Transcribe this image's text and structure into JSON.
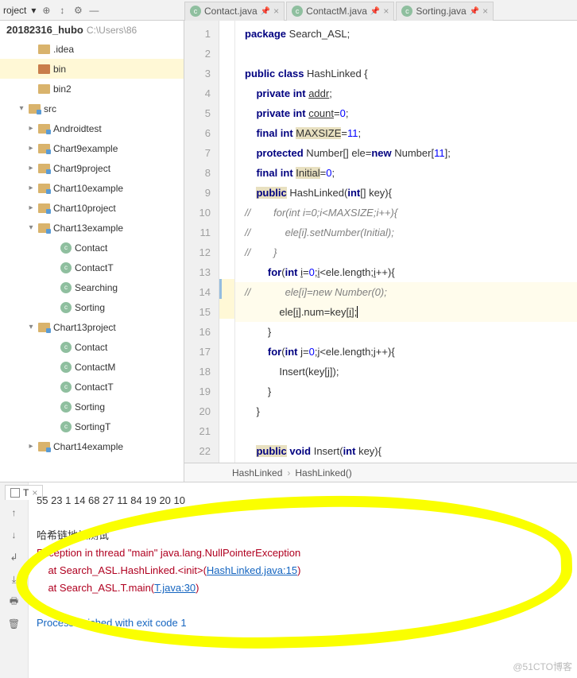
{
  "toolbar": {
    "project_label": "roject",
    "chev": "▾"
  },
  "tabs": [
    {
      "label": "Contact.java"
    },
    {
      "label": "ContactM.java"
    },
    {
      "label": "Sorting.java"
    }
  ],
  "project": {
    "root_name": "20182316_hubo",
    "root_path": "C:\\Users\\86"
  },
  "tree": [
    {
      "label": ".idea",
      "pl": 34,
      "chev": "",
      "icon": "fld"
    },
    {
      "label": "bin",
      "pl": 34,
      "chev": "",
      "icon": "fld open",
      "sel": true
    },
    {
      "label": "bin2",
      "pl": 34,
      "chev": "",
      "icon": "fld"
    },
    {
      "label": "src",
      "pl": 22,
      "chev": "▾",
      "icon": "fld blue"
    },
    {
      "label": "Androidtest",
      "pl": 34,
      "chev": "▸",
      "icon": "fld blue"
    },
    {
      "label": "Chart9example",
      "pl": 34,
      "chev": "▸",
      "icon": "fld blue"
    },
    {
      "label": "Chart9project",
      "pl": 34,
      "chev": "▸",
      "icon": "fld blue"
    },
    {
      "label": "Chart10example",
      "pl": 34,
      "chev": "▸",
      "icon": "fld blue"
    },
    {
      "label": "Chart10project",
      "pl": 34,
      "chev": "▸",
      "icon": "fld blue"
    },
    {
      "label": "Chart13example",
      "pl": 34,
      "chev": "▾",
      "icon": "fld blue"
    },
    {
      "label": "Contact",
      "pl": 62,
      "chev": "",
      "icon": "ci"
    },
    {
      "label": "ContactT",
      "pl": 62,
      "chev": "",
      "icon": "ci"
    },
    {
      "label": "Searching",
      "pl": 62,
      "chev": "",
      "icon": "ci"
    },
    {
      "label": "Sorting",
      "pl": 62,
      "chev": "",
      "icon": "ci"
    },
    {
      "label": "Chart13project",
      "pl": 34,
      "chev": "▾",
      "icon": "fld blue"
    },
    {
      "label": "Contact",
      "pl": 62,
      "chev": "",
      "icon": "ci"
    },
    {
      "label": "ContactM",
      "pl": 62,
      "chev": "",
      "icon": "ci"
    },
    {
      "label": "ContactT",
      "pl": 62,
      "chev": "",
      "icon": "ci"
    },
    {
      "label": "Sorting",
      "pl": 62,
      "chev": "",
      "icon": "ci"
    },
    {
      "label": "SortingT",
      "pl": 62,
      "chev": "",
      "icon": "ci"
    },
    {
      "label": "Chart14example",
      "pl": 34,
      "chev": "▸",
      "icon": "fld blue"
    }
  ],
  "code": {
    "lines": [
      {
        "n": 1,
        "html": "<span class='kw'>package</span> Search_ASL;"
      },
      {
        "n": 2,
        "html": ""
      },
      {
        "n": 3,
        "html": "<span class='kw'>public class</span> HashLinked {"
      },
      {
        "n": 4,
        "html": "    <span class='kw'>private int</span> <u>addr</u>;"
      },
      {
        "n": 5,
        "html": "    <span class='kw'>private int</span> <u>count</u>=<span class='num'>0</span>;"
      },
      {
        "n": 6,
        "html": "    <span class='kw'>final int</span> <span class='s-hl'>MAXSIZE</span>=<span class='num'>11</span>;"
      },
      {
        "n": 7,
        "html": "    <span class='kw'>protected</span> Number[] ele=<span class='kw'>new</span> Number[<span class='num'>11</span>];"
      },
      {
        "n": 8,
        "html": "    <span class='kw'>final int</span> <span class='s-hl'>Initial</span>=<span class='num'>0</span>;"
      },
      {
        "n": 9,
        "html": "    <span class='s-hl kw'>public</span> HashLinked(<span class='kw'>int</span>[] key){"
      },
      {
        "n": 10,
        "html": "<span class='com'>//        for(int i=0;i&lt;MAXSIZE;i++){</span>"
      },
      {
        "n": 11,
        "html": "<span class='com'>//            ele[i].setNumber(Initial);</span>"
      },
      {
        "n": 12,
        "html": "<span class='com'>//        }</span>"
      },
      {
        "n": 13,
        "html": "        <span class='kw'>for</span>(<span class='kw'>int</span> <u>i</u>=<span class='num'>0</span>;<u>i</u>&lt;ele.length;<u>i</u>++){"
      },
      {
        "n": 14,
        "html": "<span class='com'>//            ele[i]=new Number(0);</span>",
        "hl": true,
        "blue": true
      },
      {
        "n": 15,
        "html": "            ele[<u>i</u>].num=key[<u>i</u>];<span class='cursor'></span>",
        "hl": true
      },
      {
        "n": 16,
        "html": "        }"
      },
      {
        "n": 17,
        "html": "        <span class='kw'>for</span>(<span class='kw'>int</span> <u>j</u>=<span class='num'>0</span>;j&lt;ele.length;j++){"
      },
      {
        "n": 18,
        "html": "            Insert(key[j]);"
      },
      {
        "n": 19,
        "html": "        }"
      },
      {
        "n": 20,
        "html": "    }"
      },
      {
        "n": 21,
        "html": ""
      },
      {
        "n": 22,
        "html": "    <span class='s-hl kw'>public</span> <span class='kw'>void</span> Insert(<span class='kw'>int</span> key){"
      }
    ]
  },
  "breadcrumb": {
    "a": "HashLinked",
    "b": "HashLinked()"
  },
  "runtab": "T",
  "console": {
    "line1": "55 23 1 14 68 27 11 84 19 20 10",
    "line2": "哈希链地址测试",
    "line3": "Exception in thread \"main\" java.lang.NullPointerException",
    "line4a": "    at Search_ASL.HashLinked.<init>(",
    "line4b": "HashLinked.java:15",
    "line4c": ")",
    "line5a": "    at Search_ASL.T.main(",
    "line5b": "T.java:30",
    "line5c": ")",
    "line6": "Process finished with exit code 1"
  },
  "watermark": "@51CTO博客"
}
